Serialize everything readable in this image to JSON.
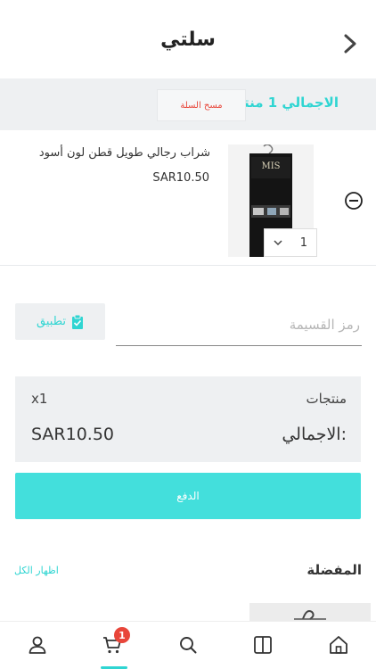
{
  "header": {
    "title": "سلتي"
  },
  "summary": {
    "total_label": "الاجمالي 1 منتج",
    "clear_label": "مسح السلة"
  },
  "cart_items": [
    {
      "name": "شراب رجالي طويل قطن لون أسود",
      "price": "SAR10.50",
      "quantity": "1",
      "brand": "MIS"
    }
  ],
  "coupon": {
    "placeholder": "رمز القسيمة",
    "apply_label": "تطبيق"
  },
  "totals": {
    "products_label": "منتجات",
    "products_count": "x1",
    "total_label": "الاجمالي:",
    "total_value": "SAR10.50"
  },
  "checkout": {
    "label": "الدفع"
  },
  "favorites": {
    "title": "المفضلة",
    "show_all_label": "اظهار الكل"
  },
  "tabbar": {
    "cart_badge": "1",
    "items": [
      "profile-icon",
      "cart-icon",
      "search-icon",
      "categories-icon",
      "home-icon"
    ],
    "active": "cart-icon"
  },
  "colors": {
    "accent": "#2fd5d2",
    "checkout": "#43dfdc",
    "danger": "#e8463a",
    "panel": "#eef0f2"
  }
}
